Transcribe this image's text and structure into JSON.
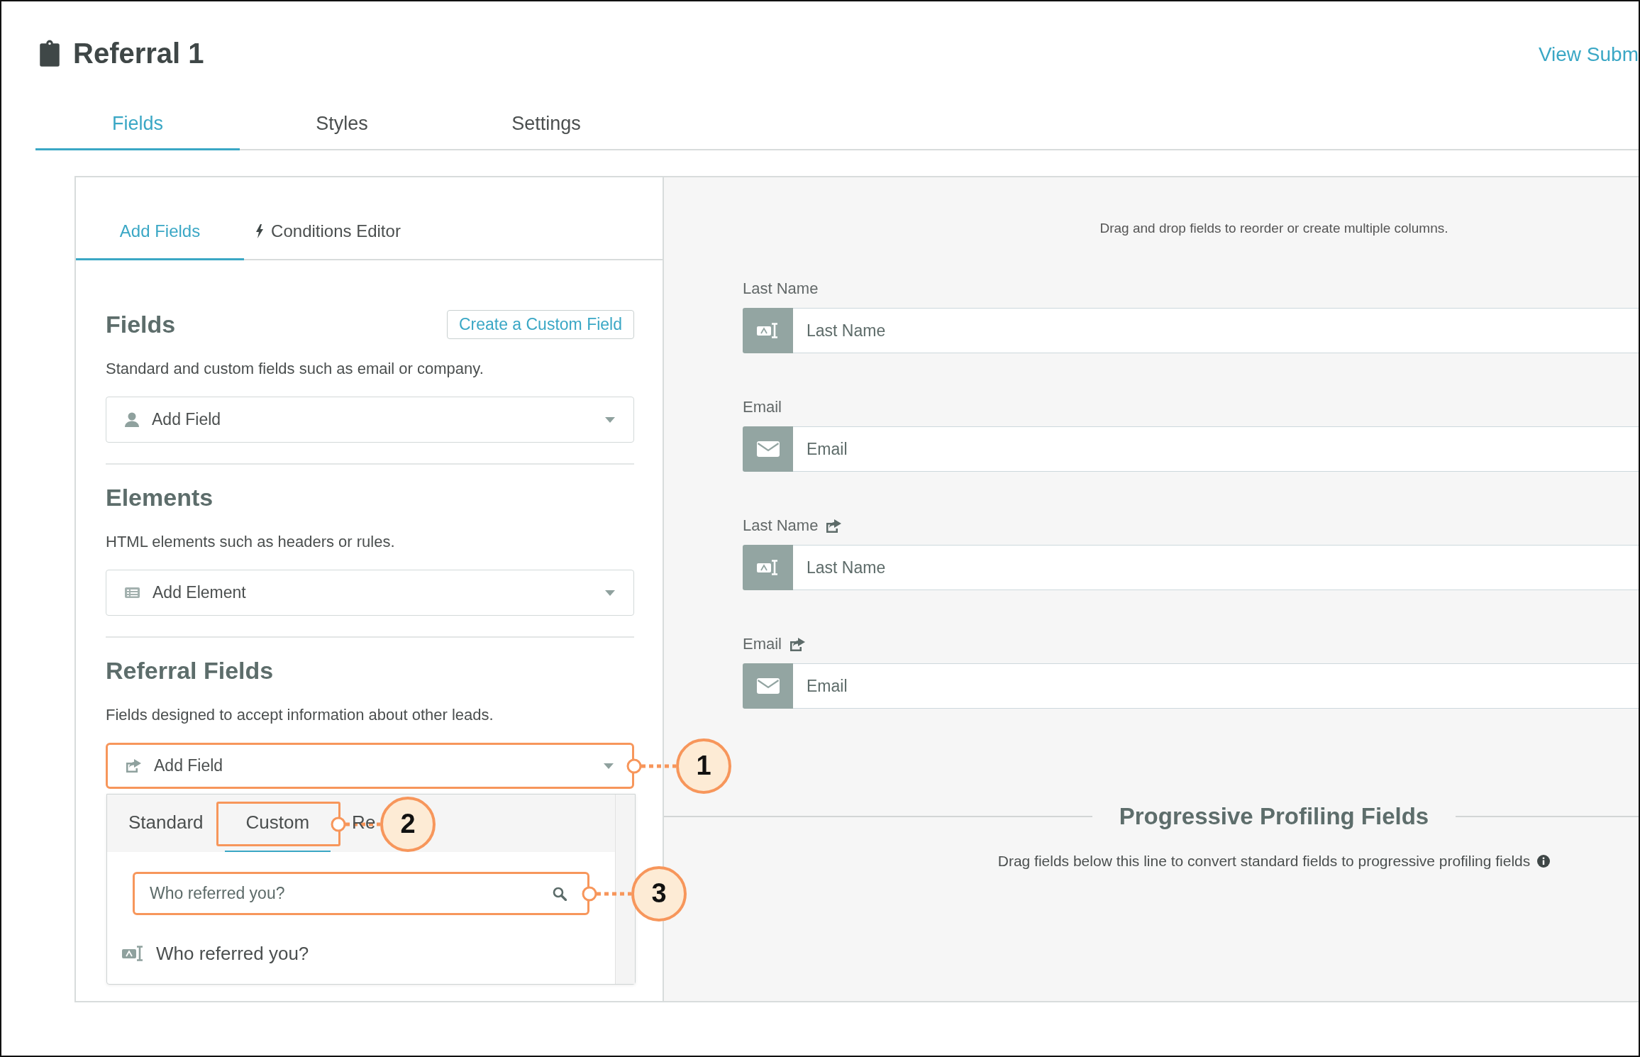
{
  "header": {
    "title": "Referral 1",
    "link": "View Subm"
  },
  "tabs": [
    {
      "label": "Fields",
      "selected": true
    },
    {
      "label": "Styles",
      "selected": false
    },
    {
      "label": "Settings",
      "selected": false
    }
  ],
  "builder": {
    "tabs": [
      {
        "label": "Add Fields",
        "selected": true,
        "kind": "plain"
      },
      {
        "label": "Conditions Editor",
        "selected": false,
        "kind": "bolt"
      }
    ],
    "sections": [
      {
        "title": "Fields",
        "button": "Create a Custom Field",
        "description": "Standard and custom fields such as email or company.",
        "dropdown": {
          "label": "Add Field",
          "kind": "person"
        }
      },
      {
        "title": "Elements",
        "description": "HTML elements such as headers or rules.",
        "dropdown": {
          "label": "Add Element",
          "kind": "element"
        }
      },
      {
        "title": "Referral Fields",
        "description": "Fields designed to accept information about other leads.",
        "dropdown": {
          "label": "Add Field",
          "kind": "share",
          "callout": "1",
          "menu": {
            "tabs": [
              {
                "label": "Standard",
                "selected": false
              },
              {
                "label": "Custom",
                "selected": true,
                "callout": "2"
              },
              {
                "label": "Re",
                "selected": false
              }
            ],
            "search": {
              "value": "Who referred you?",
              "callout": "3"
            },
            "options": [
              {
                "label": "Who referred you?",
                "kind": "text"
              }
            ]
          }
        }
      }
    ]
  },
  "preview": {
    "hint": "Drag and drop fields to reorder or create multiple columns.",
    "fields": [
      {
        "label": "Last Name",
        "placeholder": "Last Name",
        "kind": "text",
        "referral": false
      },
      {
        "label": "Email",
        "placeholder": "Email",
        "kind": "email",
        "referral": false
      },
      {
        "label": "Last Name",
        "placeholder": "Last Name",
        "kind": "text",
        "referral": true
      },
      {
        "label": "Email",
        "placeholder": "Email",
        "kind": "email",
        "referral": true
      }
    ],
    "progressive": {
      "title": "Progressive Profiling Fields",
      "hint": "Drag fields below this line to convert standard fields to progressive profiling fields"
    }
  }
}
